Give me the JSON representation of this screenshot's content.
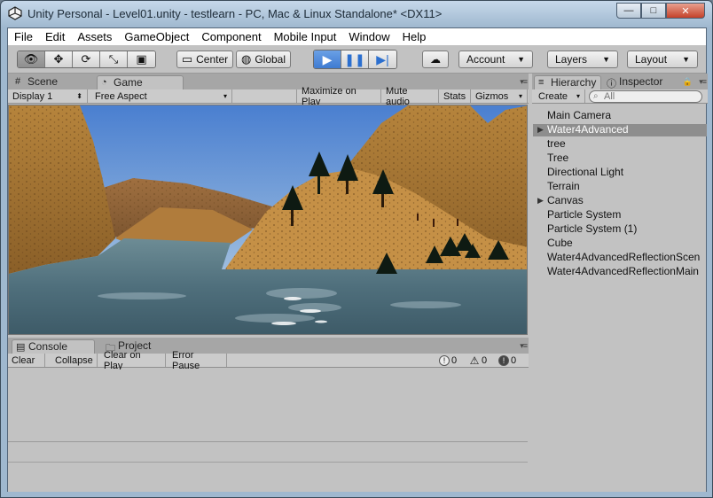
{
  "window": {
    "title": "Unity Personal - Level01.unity - testlearn - PC, Mac & Linux Standalone* <DX11>",
    "buttons": {
      "minimize": "—",
      "maximize": "□",
      "close": "✕"
    }
  },
  "menu": [
    "File",
    "Edit",
    "Assets",
    "GameObject",
    "Component",
    "Mobile Input",
    "Window",
    "Help"
  ],
  "toolbar": {
    "pivot": "Center",
    "rotation": "Global",
    "account": "Account",
    "layers": "Layers",
    "layout": "Layout"
  },
  "view_tabs": {
    "scene": "Scene",
    "game": "Game"
  },
  "game_bar": {
    "display": "Display 1",
    "aspect": "Free Aspect",
    "maximize": "Maximize on Play",
    "mute": "Mute audio",
    "stats": "Stats",
    "gizmos": "Gizmos"
  },
  "bottom_tabs": {
    "console": "Console",
    "project": "Project"
  },
  "console_bar": {
    "clear": "Clear",
    "collapse": "Collapse",
    "clear_on_play": "Clear on Play",
    "error_pause": "Error Pause",
    "info_count": "0",
    "warn_count": "0",
    "error_count": "0"
  },
  "hierarchy": {
    "tab": "Hierarchy",
    "inspector_tab": "Inspector",
    "create": "Create",
    "search_placeholder": "All",
    "items": [
      {
        "label": "Main Camera",
        "expandable": false,
        "selected": false
      },
      {
        "label": "Water4Advanced",
        "expandable": true,
        "selected": true
      },
      {
        "label": "tree",
        "expandable": false,
        "selected": false
      },
      {
        "label": "Tree",
        "expandable": false,
        "selected": false
      },
      {
        "label": "Directional Light",
        "expandable": false,
        "selected": false
      },
      {
        "label": "Terrain",
        "expandable": false,
        "selected": false
      },
      {
        "label": "Canvas",
        "expandable": true,
        "selected": false
      },
      {
        "label": "Particle System",
        "expandable": false,
        "selected": false
      },
      {
        "label": "Particle System (1)",
        "expandable": false,
        "selected": false
      },
      {
        "label": "Cube",
        "expandable": false,
        "selected": false
      },
      {
        "label": "Water4AdvancedReflectionScen",
        "expandable": false,
        "selected": false
      },
      {
        "label": "Water4AdvancedReflectionMain",
        "expandable": false,
        "selected": false
      }
    ]
  },
  "colors": {
    "selection": "#8e8e8e",
    "play_active": "#3f7bd2",
    "editor_bg": "#c2c2c2"
  }
}
